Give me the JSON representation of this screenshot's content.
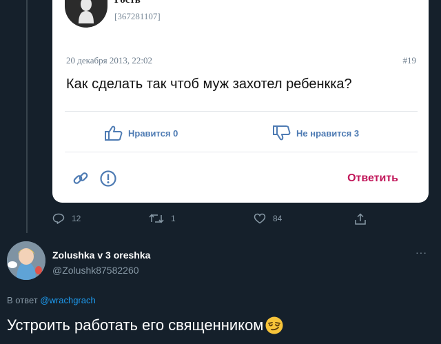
{
  "quoted_card": {
    "user_name": "Гость",
    "user_id": "[367281107]",
    "date": "20 декабря 2013, 22:02",
    "post_number": "#19",
    "question": "Как сделать так чтоб муж захотел ребенкка?",
    "like_label": "Нравится 0",
    "dislike_label": "Не нравится 3",
    "reply_label": "Ответить"
  },
  "tweet_actions": {
    "replies": "12",
    "retweets": "1",
    "likes": "84"
  },
  "reply": {
    "name": "Zolushka v 3 oreshka",
    "handle": "@Zolushk87582260",
    "more": "···",
    "in_reply_prefix": "В ответ",
    "in_reply_mention": "@wrachgrach",
    "text": "Устроить работать его священником"
  },
  "colors": {
    "background": "#15202b",
    "mention": "#1d9bf0",
    "vote": "#4e7bb3",
    "reply_accent": "#c2185b"
  },
  "icons": [
    "thumb-up-icon",
    "thumb-down-icon",
    "link-icon",
    "alert-icon",
    "reply-icon",
    "retweet-icon",
    "heart-icon",
    "share-icon",
    "more-icon",
    "smirk-emoji-icon"
  ]
}
